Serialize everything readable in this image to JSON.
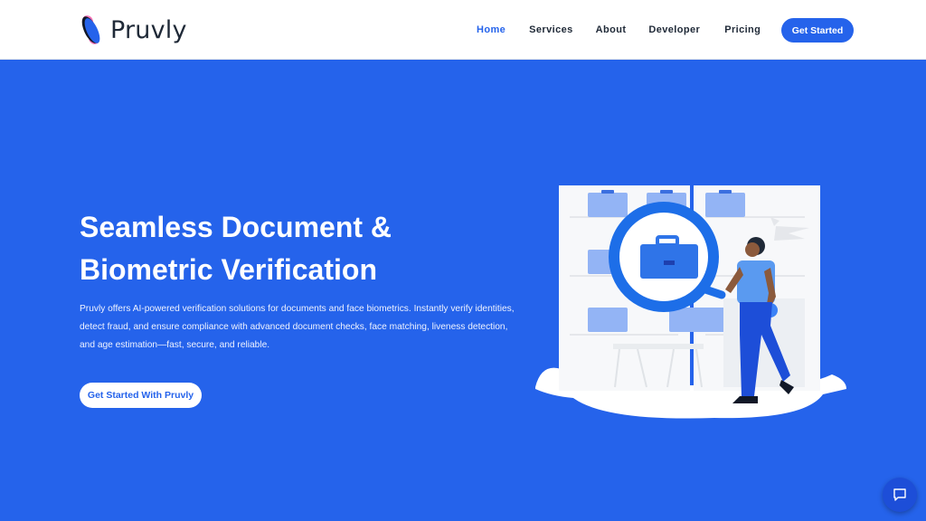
{
  "brand": {
    "name": "Pruvly"
  },
  "nav": {
    "items": [
      {
        "label": "Home",
        "active": true
      },
      {
        "label": "Services",
        "active": false
      },
      {
        "label": "About",
        "active": false
      },
      {
        "label": "Developer",
        "active": false
      },
      {
        "label": "Pricing",
        "active": false
      }
    ],
    "cta_label": "Get Started"
  },
  "hero": {
    "title_line1": "Seamless Document &",
    "title_line2": "Biometric Verification",
    "description": "Pruvly offers AI-powered verification solutions for documents and face biometrics. Instantly verify identities, detect fraud, and ensure compliance with advanced document checks, face matching, liveness detection, and age estimation—fast, secure, and reliable.",
    "cta_label": "Get Started With Pruvly"
  },
  "colors": {
    "primary": "#2563eb",
    "navbar_bg": "#ffffff",
    "logo_pink": "#f472b6",
    "logo_blue": "#2563eb",
    "logo_dark": "#111827"
  },
  "icons": {
    "chat": "chat-bubble-icon",
    "logo": "pruvly-logo-mark"
  }
}
